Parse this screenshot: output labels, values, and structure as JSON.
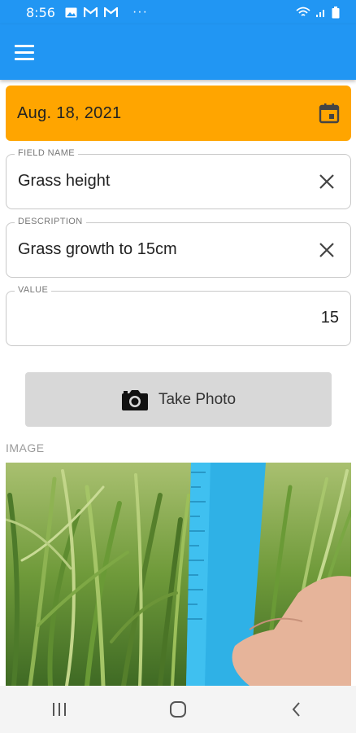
{
  "status_bar": {
    "time": "8:56",
    "more": "···",
    "icons": [
      "gallery-icon",
      "gmail-icon",
      "gmail-icon",
      "wifi-icon",
      "signal-icon",
      "battery-icon"
    ]
  },
  "app_bar": {
    "menu_icon": "hamburger-menu-icon",
    "color": "#2196f3"
  },
  "date_field": {
    "value": "Aug. 18, 2021",
    "icon": "calendar-icon",
    "color": "#ffa500"
  },
  "fields": {
    "field_name": {
      "label": "FIELD NAME",
      "value": "Grass height"
    },
    "description": {
      "label": "DESCRIPTION",
      "value": "Grass growth to 15cm"
    },
    "value": {
      "label": "VALUE",
      "value": "15"
    }
  },
  "photo_button": {
    "label": "Take Photo",
    "icon": "camera-icon"
  },
  "image_section": {
    "heading": "IMAGE"
  },
  "nav_bar": {
    "icons": [
      "recent-apps-icon",
      "home-icon",
      "back-icon"
    ]
  }
}
